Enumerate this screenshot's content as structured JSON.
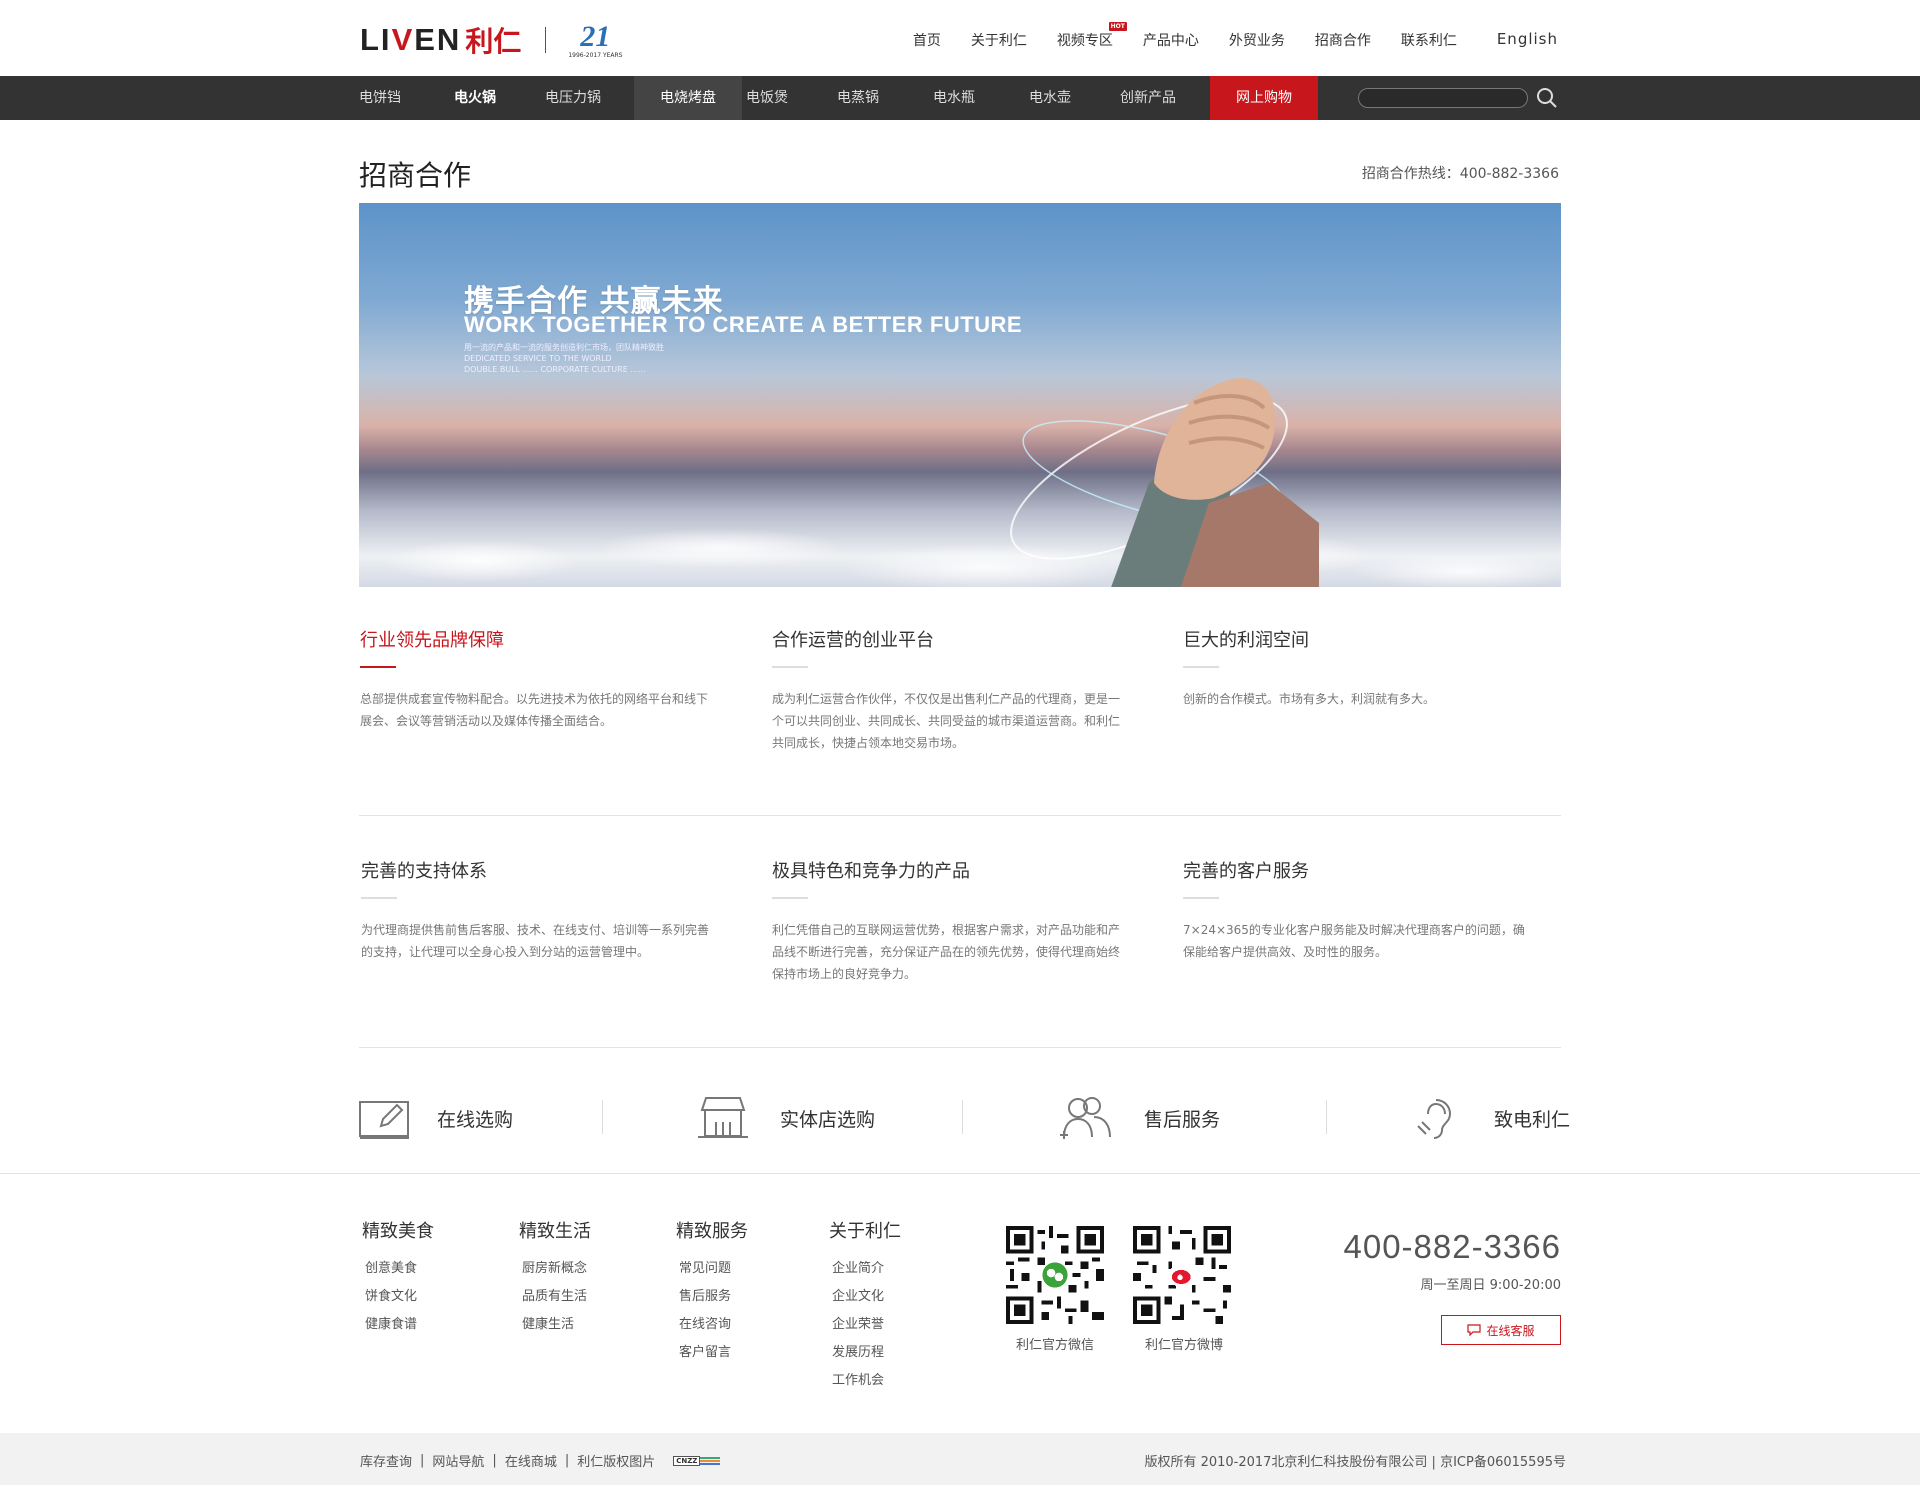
{
  "header": {
    "logo_text": "LIVEN",
    "logo_cn": "利仁",
    "anniv_number": "21",
    "anniv_text": "1996-2017 YEARS",
    "nav": [
      {
        "label": "首页"
      },
      {
        "label": "关于利仁"
      },
      {
        "label": "视频专区",
        "badge": "HOT"
      },
      {
        "label": "产品中心"
      },
      {
        "label": "外贸业务"
      },
      {
        "label": "招商合作"
      },
      {
        "label": "联系利仁"
      },
      {
        "label": "English"
      }
    ]
  },
  "catbar": {
    "items": [
      "电饼铛",
      "电火锅",
      "电压力锅",
      "电烧烤盘",
      "电饭煲",
      "电蒸锅",
      "电水瓶",
      "电水壶",
      "创新产品",
      "网上购物"
    ],
    "search_placeholder": ""
  },
  "page": {
    "title": "招商合作",
    "hotline": "招商合作热线：400-882-3366"
  },
  "banner": {
    "headline_cn": "携手合作 共赢未来",
    "headline_en": "WORK TOGETHER TO CREATE A BETTER FUTURE",
    "small_line1": "用一流的产品和一流的服务创造利仁市场，团队精神致胜",
    "small_line2": "DEDICATED SERVICE TO THE WORLD",
    "small_line3": "DOUBLE BULL ...... CORPORATE CULTURE ......"
  },
  "features": [
    {
      "title": "行业领先品牌保障",
      "text": "总部提供成套宣传物料配合。以先进技术为依托的网络平台和线下展会、会议等营销活动以及媒体传播全面结合。"
    },
    {
      "title": "合作运营的创业平台",
      "text": "成为利仁运营合作伙伴，不仅仅是出售利仁产品的代理商，更是一个可以共同创业、共同成长、共同受益的城市渠道运营商。和利仁共同成长，快捷占领本地交易市场。"
    },
    {
      "title": "巨大的利润空间",
      "text": "创新的合作模式。市场有多大，利润就有多大。"
    },
    {
      "title": "完善的支持体系",
      "text": "为代理商提供售前售后客服、技术、在线支付、培训等一系列完善的支持，让代理可以全身心投入到分站的运营管理中。"
    },
    {
      "title": "极具特色和竞争力的产品",
      "text": "利仁凭借自己的互联网运营优势，根据客户需求，对产品功能和产品线不断进行完善，充分保证产品在的领先优势，使得代理商始终保持市场上的良好竞争力。"
    },
    {
      "title": "完善的客户服务",
      "text": "7×24×365的专业化客户服务能及时解决代理商客户的问题，确保能给客户提供高效、及时性的服务。"
    }
  ],
  "services": [
    {
      "label": "在线选购",
      "icon": "edit-icon"
    },
    {
      "label": "实体店选购",
      "icon": "store-icon"
    },
    {
      "label": "售后服务",
      "icon": "users-icon"
    },
    {
      "label": "致电利仁",
      "icon": "phone-icon"
    }
  ],
  "footer": {
    "columns": [
      {
        "title": "精致美食",
        "links": [
          "创意美食",
          "饼食文化",
          "健康食谱"
        ]
      },
      {
        "title": "精致生活",
        "links": [
          "厨房新概念",
          "品质有生活",
          "健康生活"
        ]
      },
      {
        "title": "精致服务",
        "links": [
          "常见问题",
          "售后服务",
          "在线咨询",
          "客户留言"
        ]
      },
      {
        "title": "关于利仁",
        "links": [
          "企业简介",
          "企业文化",
          "企业荣誉",
          "发展历程",
          "工作机会"
        ]
      }
    ],
    "qr_wechat_caption": "利仁官方微信",
    "qr_weibo_caption": "利仁官方微博",
    "phone": "400-882-3366",
    "hours": "周一至周日 9:00-20:00",
    "chat_label": "在线客服"
  },
  "bottombar": {
    "links": [
      "库存查询",
      "网站导航",
      "在线商城",
      "利仁版权图片"
    ],
    "cnzz": "CNZZ",
    "copyright": "版权所有  2010-2017北京利仁科技股份有限公司 | 京ICP备06015595号"
  },
  "colors": {
    "accent": "#c8161d",
    "catbar_bg": "#333333"
  }
}
